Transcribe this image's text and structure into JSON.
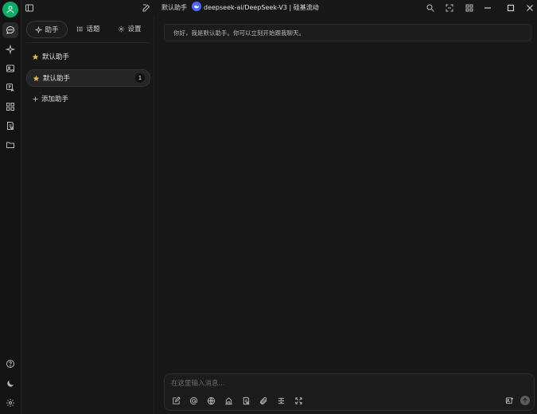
{
  "topbar": {
    "assistant_name": "默认助手",
    "model_name": "deepseek-ai/DeepSeek-V3 | 硅基流动"
  },
  "rail": {
    "items": [
      "chat-icon",
      "sparkle-icon",
      "image-icon",
      "translate-icon",
      "apps-icon",
      "knowledge-icon",
      "folder-icon"
    ],
    "bottom": [
      "help-icon",
      "moon-icon",
      "gear-icon"
    ]
  },
  "panel": {
    "tabs": [
      {
        "label": "助手",
        "icon": "sparkle-icon"
      },
      {
        "label": "话题",
        "icon": "list-icon"
      },
      {
        "label": "设置",
        "icon": "gear-icon"
      }
    ],
    "assistants": [
      {
        "name": "默认助手"
      },
      {
        "name": "默认助手",
        "badge": "1"
      }
    ],
    "add_label": "添加助手"
  },
  "chat": {
    "greeting": "你好，我是默认助手。你可以立刻开始跟我聊天。"
  },
  "input": {
    "placeholder": "在这里输入消息...",
    "value": ""
  },
  "colors": {
    "background": "#181818",
    "avatar": "#0fa968",
    "star": "#e8b84a",
    "model_logo": "#4d6bfe"
  }
}
